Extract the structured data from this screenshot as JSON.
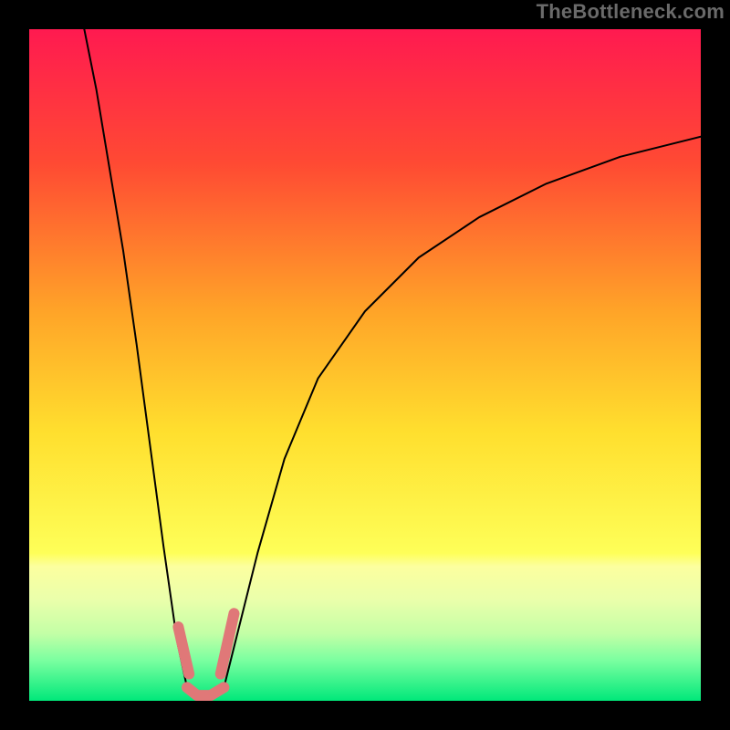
{
  "watermark": {
    "text": "TheBottleneck.com"
  },
  "chart_data": {
    "type": "line",
    "title": "",
    "xlabel": "",
    "ylabel": "",
    "xlim": [
      0,
      100
    ],
    "ylim": [
      0,
      100
    ],
    "grid": false,
    "legend": false,
    "background": {
      "type": "vertical-gradient",
      "stops": [
        {
          "pct": 0,
          "color": "#ff1a50"
        },
        {
          "pct": 20,
          "color": "#ff4a33"
        },
        {
          "pct": 42,
          "color": "#ffa428"
        },
        {
          "pct": 60,
          "color": "#ffdf2e"
        },
        {
          "pct": 78,
          "color": "#feff58"
        },
        {
          "pct": 80,
          "color": "#fcff9f"
        },
        {
          "pct": 85,
          "color": "#eaffab"
        },
        {
          "pct": 90,
          "color": "#c3ffa6"
        },
        {
          "pct": 94,
          "color": "#7affa0"
        },
        {
          "pct": 100,
          "color": "#00e87a"
        }
      ]
    },
    "series": [
      {
        "name": "left-descent",
        "x": [
          8.2,
          10,
          12,
          14,
          16,
          18,
          20,
          22,
          23.5
        ],
        "y": [
          100,
          91,
          79,
          67,
          53,
          38,
          23,
          9,
          2
        ],
        "stroke": "#000",
        "width": 2
      },
      {
        "name": "right-ascent",
        "x": [
          29,
          31,
          34,
          38,
          43,
          50,
          58,
          67,
          77,
          88,
          100
        ],
        "y": [
          2,
          10,
          22,
          36,
          48,
          58,
          66,
          72,
          77,
          81,
          84
        ],
        "stroke": "#000",
        "width": 2
      },
      {
        "name": "optimal-flat",
        "x": [
          23.5,
          25,
          27,
          29
        ],
        "y": [
          2,
          0.8,
          0.8,
          2
        ],
        "stroke": "#e07878",
        "width": 12
      },
      {
        "name": "optimal-left-tick",
        "x": [
          22.2,
          23.8
        ],
        "y": [
          11,
          4
        ],
        "stroke": "#e07878",
        "width": 12
      },
      {
        "name": "optimal-right-tick",
        "x": [
          28.5,
          30.5
        ],
        "y": [
          4,
          13
        ],
        "stroke": "#e07878",
        "width": 12
      }
    ],
    "annotations": []
  }
}
